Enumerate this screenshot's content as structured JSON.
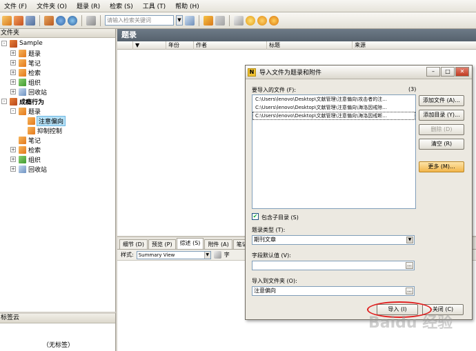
{
  "menu": [
    "文件 (F)",
    "文件夹 (O)",
    "题录 (R)",
    "检索 (S)",
    "工具 (T)",
    "帮助 (H)"
  ],
  "toolbar": {
    "search_placeholder": "请输入检索关键词"
  },
  "left_panel": {
    "title": "文件夹",
    "tree": [
      {
        "label": "Sample",
        "level": 0,
        "expander": "-",
        "icon": "library-icon"
      },
      {
        "label": "题录",
        "level": 1,
        "expander": "+",
        "icon": "folder-icon"
      },
      {
        "label": "笔记",
        "level": 1,
        "expander": "+",
        "icon": "folder-icon"
      },
      {
        "label": "检索",
        "level": 1,
        "expander": "+",
        "icon": "folder-icon"
      },
      {
        "label": "组织",
        "level": 1,
        "expander": "+",
        "icon": "organize-icon"
      },
      {
        "label": "回收站",
        "level": 1,
        "expander": "+",
        "icon": "recycle-bin-icon"
      },
      {
        "label": "成瘾行为",
        "level": 0,
        "expander": "-",
        "icon": "library-icon",
        "bold": true
      },
      {
        "label": "题录",
        "level": 1,
        "expander": "-",
        "icon": "folder-icon"
      },
      {
        "label": "注意偏向",
        "level": 2,
        "expander": "",
        "icon": "folder-icon",
        "selected": true
      },
      {
        "label": "抑制控制",
        "level": 2,
        "expander": "",
        "icon": "folder-icon"
      },
      {
        "label": "笔记",
        "level": 1,
        "expander": "",
        "icon": "folder-icon"
      },
      {
        "label": "检索",
        "level": 1,
        "expander": "+",
        "icon": "folder-icon"
      },
      {
        "label": "组织",
        "level": 1,
        "expander": "+",
        "icon": "organize-icon"
      },
      {
        "label": "回收站",
        "level": 1,
        "expander": "+",
        "icon": "recycle-bin-icon"
      }
    ],
    "tags_title": "标签云",
    "no_tags": "（无标签）"
  },
  "main": {
    "title": "题录",
    "columns": [
      "年份",
      "作者",
      "标题",
      "来源"
    ],
    "tabs": [
      "细节 (D)",
      "预览 (P)",
      "综述 (S)",
      "附件 (A)",
      "笔记"
    ],
    "active_tab": "综述 (S)",
    "style_label": "样式:",
    "style_value": "Summary View",
    "style_extra": "字"
  },
  "dialog": {
    "icon_letter": "N",
    "title": "导入文件为题录和附件",
    "files_label": "要导入的文件 (F):",
    "files_count": "(3)",
    "files": [
      "C:\\Users\\lenovo\\Desktop\\文献管理\\注意偏向\\攻击者的注...",
      "C:\\Users\\lenovo\\Desktop\\文献管理\\注意偏向\\海洛因戒除...",
      "C:\\Users\\lenovo\\Desktop\\文献管理\\注意偏向\\海洛因戒断..."
    ],
    "buttons": {
      "add_file": "添加文件 (A)...",
      "add_dir": "添加目录 (Y)...",
      "delete": "删除 (D)",
      "clear": "清空 (R)",
      "more": "更多 (M)..."
    },
    "include_subdirs_label": "包含子目录 (S)",
    "include_subdirs_checked": "✔",
    "type_label": "题录类型 (T):",
    "type_value": "期刊文章",
    "default_label": "字段默认值 (V):",
    "default_value": "",
    "folder_label": "导入到文件夹 (O):",
    "folder_value": "注意偏向",
    "import_btn": "导入 (I)",
    "close_btn": "关闭 (C)"
  },
  "watermark": "Baidu 经验"
}
